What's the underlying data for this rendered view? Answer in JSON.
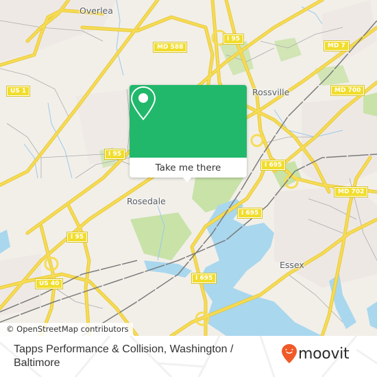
{
  "map": {
    "place_labels": [
      {
        "name": "Overlea"
      },
      {
        "name": "Rossville"
      },
      {
        "name": "Rosedale"
      },
      {
        "name": "Essex"
      }
    ],
    "route_shields": [
      {
        "label": "MD 588"
      },
      {
        "label": "I 95"
      },
      {
        "label": "MD 7"
      },
      {
        "label": "US 1"
      },
      {
        "label": "MD 700"
      },
      {
        "label": "I 95"
      },
      {
        "label": "I 695"
      },
      {
        "label": "MD 702"
      },
      {
        "label": "I 695"
      },
      {
        "label": "I 95"
      },
      {
        "label": "US 40"
      },
      {
        "label": "I 695"
      }
    ],
    "attribution": "© OpenStreetMap contributors",
    "colors": {
      "land": "#f2efe9",
      "water": "#a9d7ee",
      "park": "#c8e2a8",
      "road": "#f6dc55",
      "rail": "#777777",
      "accent": "#21b86b"
    }
  },
  "popup": {
    "icon": "map-pin-icon",
    "button_label": "Take me there"
  },
  "footer": {
    "title": "Tapps Performance & Collision, Washington / Baltimore",
    "brand": "moovit",
    "brand_icon": "moovit-pin-icon",
    "brand_color": "#f05a28"
  }
}
